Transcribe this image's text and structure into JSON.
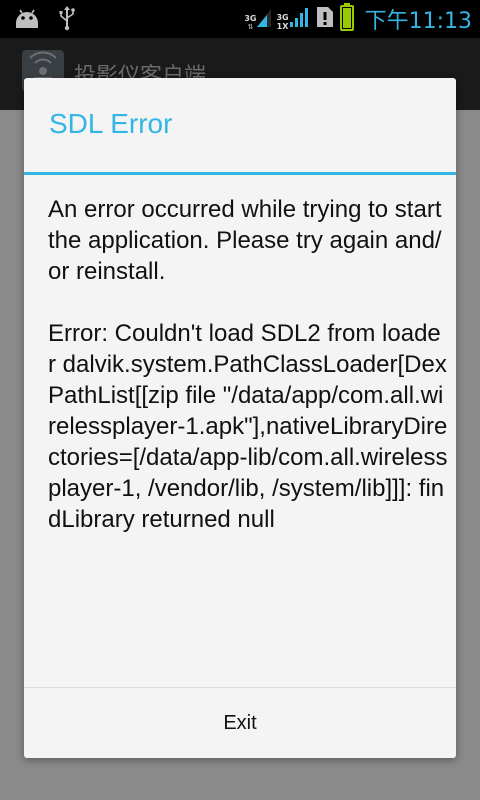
{
  "status_bar": {
    "network_1": "3G",
    "network_2_top": "3G",
    "network_2_bottom": "1X",
    "clock": "下午11:13",
    "icons": [
      "android-notification-icon",
      "usb-icon",
      "signal-icon",
      "signal-icon",
      "sim-alert-icon",
      "battery-icon"
    ]
  },
  "app": {
    "title": "投影仪客户端"
  },
  "dialog": {
    "title": "SDL Error",
    "message": "An error occurred while trying to start the application. Please try again and/or reinstall.\n\nError: Couldn't load SDL2 from loader dalvik.system.PathClassLoader[DexPathList[[zip file \"/data/app/com.all.wirelessplayer-1.apk\"],nativeLibraryDirectories=[/data/app-lib/com.all.wirelessplayer-1, /vendor/lib, /system/lib]]]: findLibrary returned null",
    "button_label": "Exit"
  },
  "colors": {
    "accent": "#33b5e5",
    "dialog_bg": "#f4f4f4",
    "text": "#111111"
  }
}
